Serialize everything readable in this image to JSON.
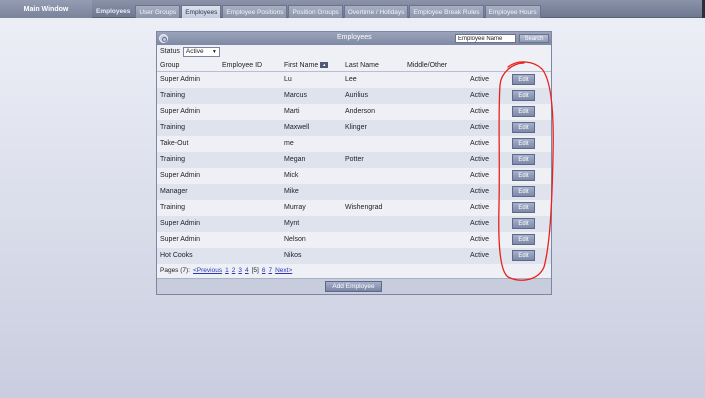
{
  "window": {
    "title": "Main Window"
  },
  "tabs": [
    {
      "label": "Employees",
      "active": false,
      "first": true
    },
    {
      "label": "User Groups",
      "active": false
    },
    {
      "label": "Employees",
      "active": true
    },
    {
      "label": "Employee Positions",
      "active": false
    },
    {
      "label": "Position Groups",
      "active": false
    },
    {
      "label": "Overtime / Holidays",
      "active": false
    },
    {
      "label": "Employee Break Rules",
      "active": false
    },
    {
      "label": "Employee Hours",
      "active": false
    }
  ],
  "panel": {
    "title": "Employees",
    "search": {
      "value": "Employee Name",
      "button_label": "Search"
    },
    "status": {
      "label": "Status",
      "selected": "Active"
    }
  },
  "columns": {
    "group": "Group",
    "employee_id": "Employee ID",
    "first_name": "First Name",
    "last_name": "Last Name",
    "middle": "Middle/Other"
  },
  "rows": [
    {
      "group": "Super Admin",
      "first": "Lu",
      "last": "Lee",
      "status": "Active",
      "edit": "Edit"
    },
    {
      "group": "Training",
      "first": "Marcus",
      "last": "Aurilius",
      "status": "Active",
      "edit": "Edit"
    },
    {
      "group": "Super Admin",
      "first": "Marti",
      "last": "Anderson",
      "status": "Active",
      "edit": "Edit"
    },
    {
      "group": "Training",
      "first": "Maxwell",
      "last": "Klinger",
      "status": "Active",
      "edit": "Edit"
    },
    {
      "group": "Take-Out",
      "first": "me",
      "last": "",
      "status": "Active",
      "edit": "Edit"
    },
    {
      "group": "Training",
      "first": "Megan",
      "last": "Potter",
      "status": "Active",
      "edit": "Edit"
    },
    {
      "group": "Super Admin",
      "first": "Mick",
      "last": "",
      "status": "Active",
      "edit": "Edit"
    },
    {
      "group": "Manager",
      "first": "Mike",
      "last": "",
      "status": "Active",
      "edit": "Edit"
    },
    {
      "group": "Training",
      "first": "Murray",
      "last": "Wishengrad",
      "status": "Active",
      "edit": "Edit"
    },
    {
      "group": "Super Admin",
      "first": "Mynt",
      "last": "",
      "status": "Active",
      "edit": "Edit"
    },
    {
      "group": "Super Admin",
      "first": "Nelson",
      "last": "",
      "status": "Active",
      "edit": "Edit"
    },
    {
      "group": "Hot Cooks",
      "first": "Nikos",
      "last": "",
      "status": "Active",
      "edit": "Edit"
    }
  ],
  "pagination": {
    "label": "Pages (7):",
    "previous": "<Previous",
    "pages": [
      "1",
      "2",
      "3",
      "4"
    ],
    "current": "[5]",
    "after": [
      "6",
      "7"
    ],
    "next": "Next>"
  },
  "footer": {
    "add_label": "Add Employee"
  },
  "colors": {
    "annotation": "#e8211d",
    "link": "#2a39b8"
  }
}
